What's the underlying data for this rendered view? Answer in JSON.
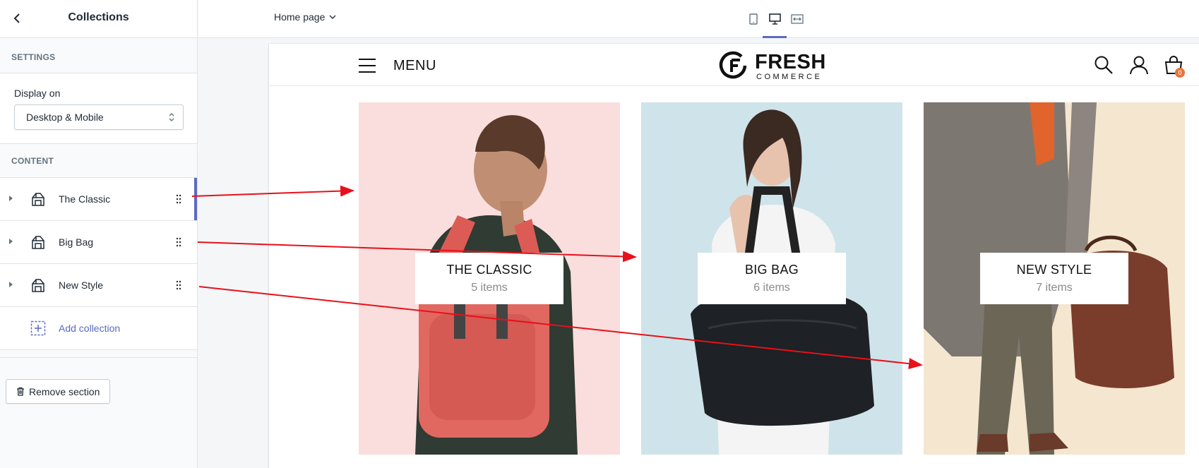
{
  "sidebar": {
    "title": "Collections",
    "settings_label": "SETTINGS",
    "display_on_label": "Display on",
    "display_on_value": "Desktop & Mobile",
    "content_label": "CONTENT",
    "items": [
      {
        "label": "The Classic"
      },
      {
        "label": "Big Bag"
      },
      {
        "label": "New Style"
      }
    ],
    "add_label": "Add collection",
    "remove_label": "Remove section"
  },
  "topbar": {
    "page_select": "Home page"
  },
  "preview": {
    "menu_label": "MENU",
    "logo_word": "FRESH",
    "logo_sub": "COMMERCE",
    "cart_count": "0",
    "cards": [
      {
        "title": "THE CLASSIC",
        "count": "5 items",
        "bg_color": "#f9dedd"
      },
      {
        "title": "BIG BAG",
        "count": "6 items",
        "bg_color": "#cfe3ea"
      },
      {
        "title": "NEW STYLE",
        "count": "7 items",
        "bg_color": "#f5e6d0"
      }
    ]
  },
  "colors": {
    "accent": "#5c6ac4",
    "arrow": "#e8101a",
    "badge": "#e8743b"
  }
}
